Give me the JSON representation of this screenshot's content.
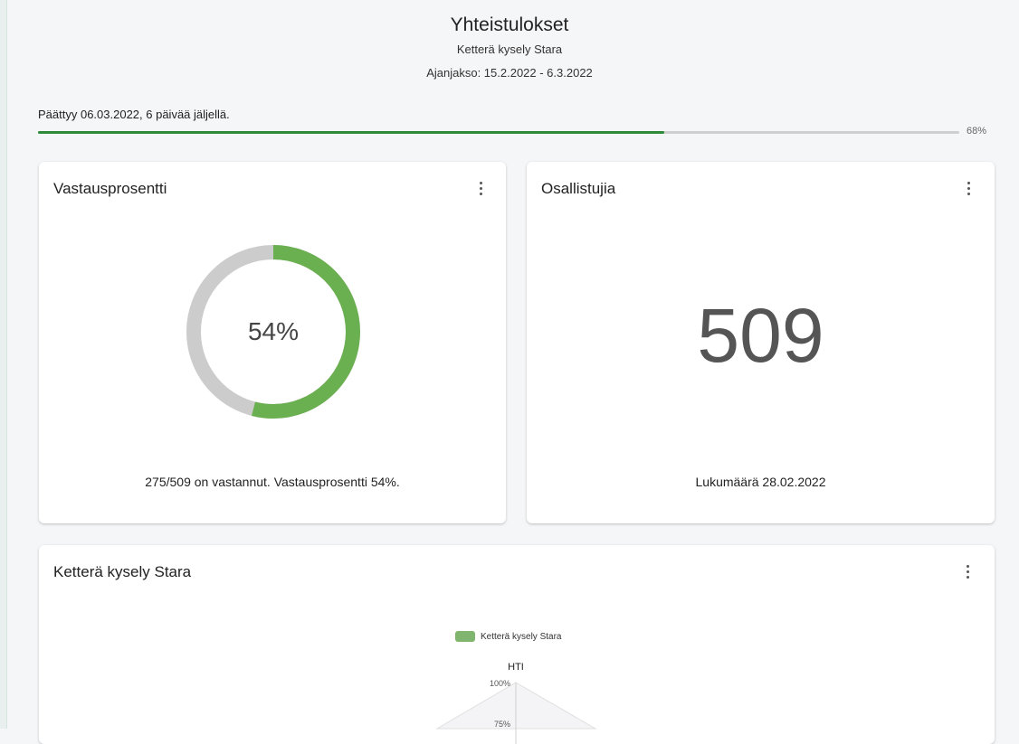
{
  "header": {
    "title": "Yhteistulokset",
    "subtitle": "Ketterä kysely Stara",
    "period": "Ajanjakso: 15.2.2022 - 6.3.2022"
  },
  "progress": {
    "label": "Päättyy 06.03.2022, 6 päivää jäljellä.",
    "percent_text": "68%",
    "value": 68,
    "color": "#2e8b3a"
  },
  "response_card": {
    "title": "Vastausprosentti",
    "menu_icon": "kebab-menu-icon",
    "donut_value": 54,
    "donut_text": "54%",
    "footer": "275/509 on vastannut. Vastausprosentti 54%.",
    "colors": {
      "filled": "#6aaf50",
      "remaining": "#cccccc"
    }
  },
  "participants_card": {
    "title": "Osallistujia",
    "menu_icon": "kebab-menu-icon",
    "count": "509",
    "footer": "Lukumäärä 28.02.2022"
  },
  "chart_card": {
    "title": "Ketterä kysely Stara",
    "menu_icon": "kebab-menu-icon"
  },
  "chart_data": {
    "type": "radar",
    "legend": [
      "Ketterä kysely Stara"
    ],
    "axes": [
      "HTI"
    ],
    "tick_labels": [
      "100%",
      "75%"
    ],
    "rlim": [
      0,
      100
    ],
    "legend_color": "#7fb56e",
    "legend_position": "top-center"
  }
}
